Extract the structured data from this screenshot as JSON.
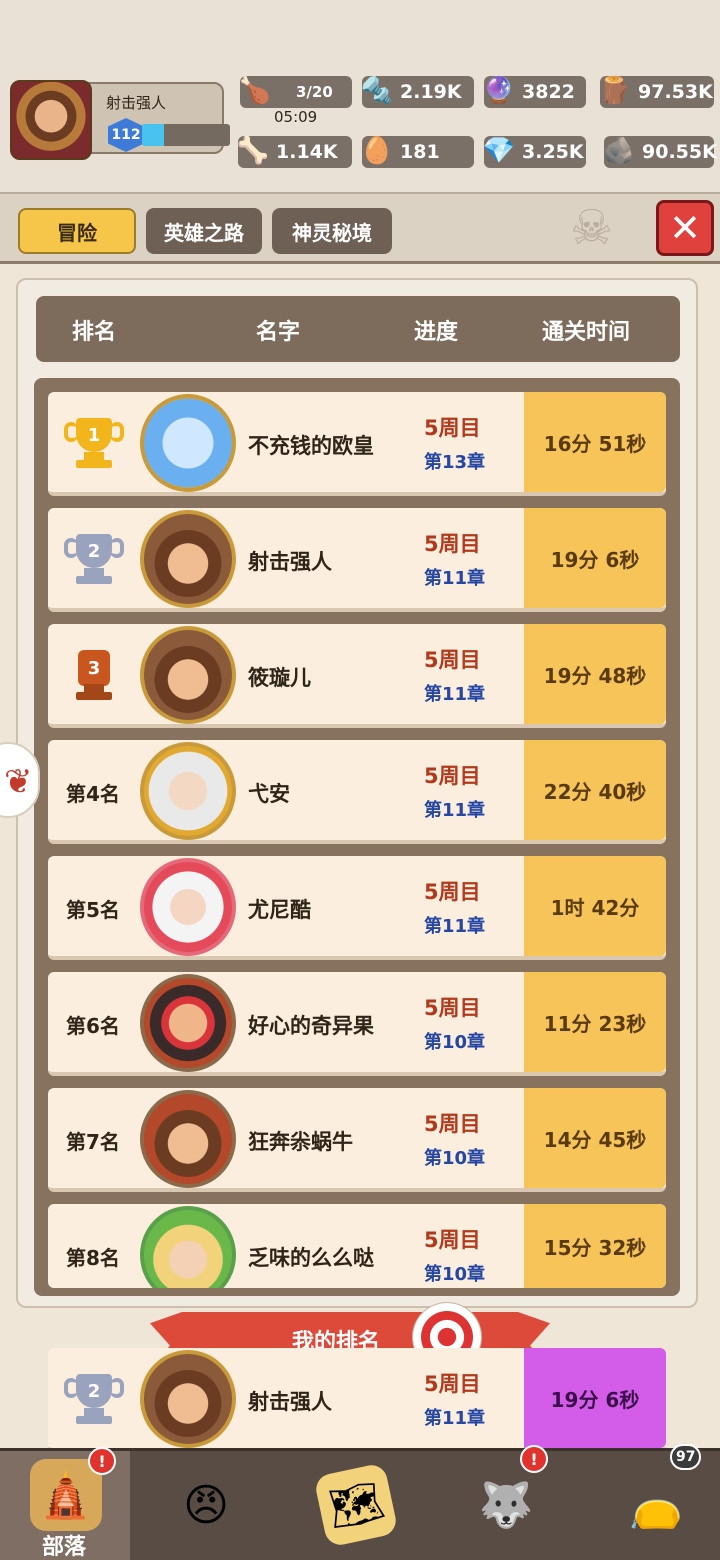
{
  "player": {
    "name": "射击强人",
    "level": "112",
    "xp_fraction": 0.25
  },
  "resources": {
    "energy": "3/20",
    "energy_timer": "05:09",
    "nuts": "2.19K",
    "orbs": "3822",
    "wood": "97.53K",
    "bones": "1.14K",
    "eggs": "181",
    "gems": "3.25K",
    "stone": "90.55K"
  },
  "tabs": [
    "冒险",
    "英雄之路",
    "神灵秘境"
  ],
  "table_header": {
    "rank": "排名",
    "name": "名字",
    "progress": "进度",
    "clear_time": "通关时间"
  },
  "rows": [
    {
      "rank": "1",
      "name": "不充钱的欧皇",
      "cycle": "5周目",
      "chapter": "第13章",
      "time": "16分 51秒"
    },
    {
      "rank": "2",
      "name": "射击强人",
      "cycle": "5周目",
      "chapter": "第11章",
      "time": "19分 6秒"
    },
    {
      "rank": "3",
      "name": "筱璇儿",
      "cycle": "5周目",
      "chapter": "第11章",
      "time": "19分 48秒"
    },
    {
      "rank": "第4名",
      "name": "弋安",
      "cycle": "5周目",
      "chapter": "第11章",
      "time": "22分 40秒"
    },
    {
      "rank": "第5名",
      "name": "尤尼酷",
      "cycle": "5周目",
      "chapter": "第11章",
      "time": "1时 42分"
    },
    {
      "rank": "第6名",
      "name": "好心的奇异果",
      "cycle": "5周目",
      "chapter": "第10章",
      "time": "11分 23秒"
    },
    {
      "rank": "第7名",
      "name": "狂奔尜蜗牛",
      "cycle": "5周目",
      "chapter": "第10章",
      "time": "14分 45秒"
    },
    {
      "rank": "第8名",
      "name": "乏味的么么哒",
      "cycle": "5周目",
      "chapter": "第10章",
      "time": "15分 32秒"
    }
  ],
  "my_rank": {
    "banner": "我的排名",
    "rank": "2",
    "name": "射击强人",
    "cycle": "5周目",
    "chapter": "第11章",
    "time": "19分 6秒"
  },
  "bottom_nav": {
    "active_label": "部落",
    "alert": "!",
    "bag_count": "97"
  },
  "colors": {
    "accent_gold": "#f7c45a",
    "my_time": "#d35de8",
    "close_red": "#e0413d"
  }
}
